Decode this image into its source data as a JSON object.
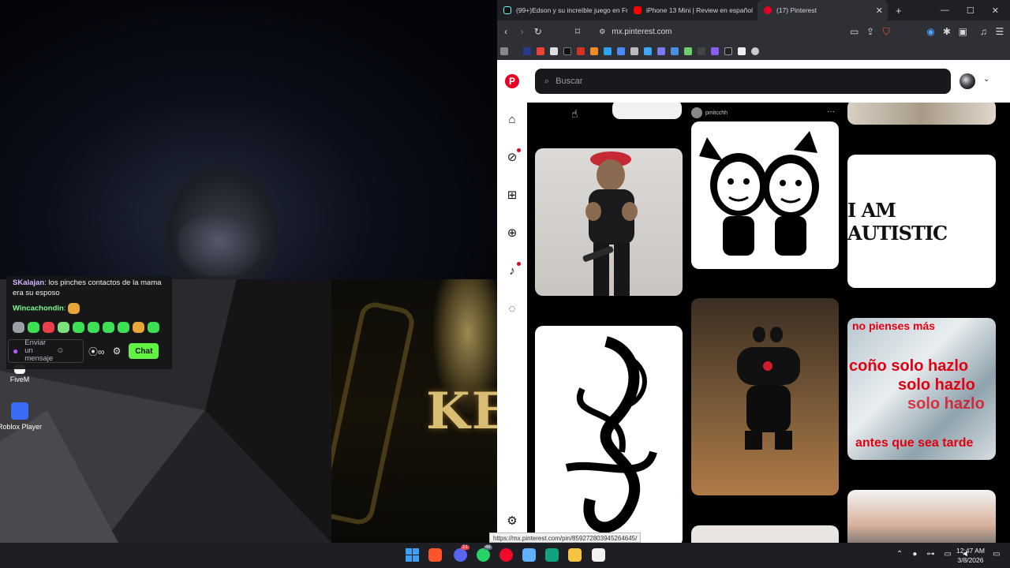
{
  "desktop": {
    "icons": [
      {
        "label": "FiveM",
        "icon": "fivem-icon",
        "color": "#f5f5f7"
      },
      {
        "label": "Roblox Player",
        "icon": "roblox-icon",
        "color": "#3b6cf6"
      }
    ],
    "game_art_text": "KER"
  },
  "chat": {
    "messages": [
      {
        "user": "SKalajan",
        "user_color": "#d6b4ff",
        "text": "los pinches contactos de la mama era su esposo"
      },
      {
        "user": "Wincachondin",
        "user_color": "#7dfb8a",
        "text": ""
      }
    ],
    "input_placeholder": "Enviar un mensaje",
    "chat_button": "Chat",
    "accent": "#61f442"
  },
  "browser": {
    "tabs": [
      {
        "title": "(99+)Edson y su increíble juego en Fr",
        "icon": "tiktok-icon",
        "color": "#111111",
        "active": false
      },
      {
        "title": "iPhone 13 Mini | Review en español",
        "icon": "youtube-icon",
        "color": "#ff0000",
        "active": false
      },
      {
        "title": "(17) Pinterest",
        "icon": "pinterest-icon",
        "color": "#e60023",
        "active": true
      }
    ],
    "url": "mx.pinterest.com",
    "status_url": "https://mx.pinterest.com/pin/85927280394526464​5/"
  },
  "pinterest": {
    "brand_color": "#e60023",
    "search_placeholder": "Buscar",
    "pins": {
      "author": "pmitcchh",
      "autistic_text": "I AM AUTISTIC",
      "meme_lines": [
        "no pienses más",
        "coño solo hazlo",
        "solo hazlo",
        "solo hazlo",
        "antes que sea tarde"
      ]
    }
  },
  "taskbar": {
    "time": "12:47 AM",
    "date": "3/8/2026",
    "discord_badge": "21",
    "whatsapp_badge": "46"
  }
}
